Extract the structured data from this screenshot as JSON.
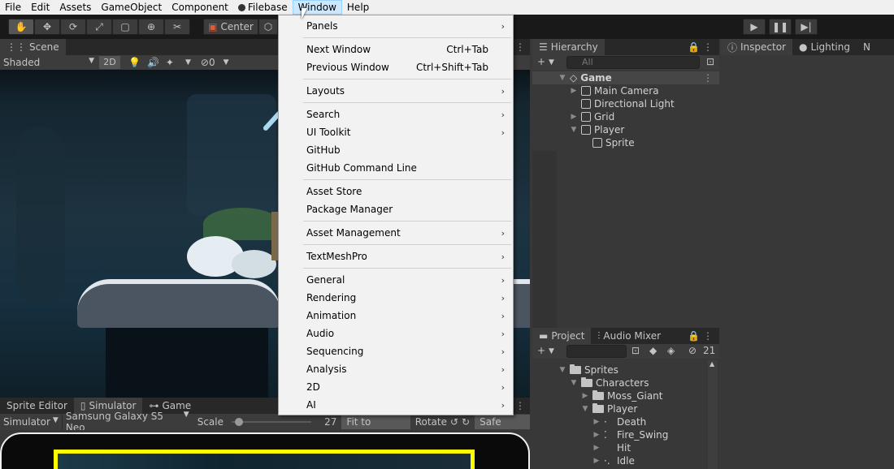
{
  "menubar": {
    "items": [
      "File",
      "Edit",
      "Assets",
      "GameObject",
      "Component",
      "Filebase",
      "Window",
      "Help"
    ],
    "active": "Window"
  },
  "toolbar": {
    "pivot_label": "Center"
  },
  "scene": {
    "tab_label": "Scene",
    "shading": "Shaded",
    "mode_2d": "2D",
    "hidden_count": "0"
  },
  "hierarchy": {
    "tab_label": "Hierarchy",
    "search_placeholder": "All",
    "rows": [
      {
        "label": "Game",
        "bold": true
      },
      {
        "label": "Main Camera"
      },
      {
        "label": "Directional Light"
      },
      {
        "label": "Grid"
      },
      {
        "label": "Player"
      },
      {
        "label": "Sprite"
      }
    ]
  },
  "inspector": {
    "tabs": [
      "Inspector",
      "Lighting",
      "N"
    ]
  },
  "project": {
    "tabs": [
      "Project",
      "Audio Mixer"
    ],
    "hidden_count": "21",
    "rows": [
      {
        "label": "Sprites"
      },
      {
        "label": "Characters"
      },
      {
        "label": "Moss_Giant"
      },
      {
        "label": "Player"
      },
      {
        "label": "Death"
      },
      {
        "label": "Fire_Swing"
      },
      {
        "label": "Hit"
      },
      {
        "label": "Idle"
      }
    ]
  },
  "bottom_tabs": [
    "Sprite Editor",
    "Simulator",
    "Game"
  ],
  "simulator": {
    "mode": "Simulator",
    "device": "Samsung Galaxy S5 Neo",
    "scale_label": "Scale",
    "scale_value": "27",
    "scale_fraction": 0.05,
    "fit_label": "Fit to Screen",
    "rotate_label": "Rotate",
    "safe_area_label": "Safe Area"
  },
  "window_menu": {
    "items": [
      {
        "label": "Panels",
        "submenu": true
      },
      {
        "label": "Next Window",
        "shortcut": "Ctrl+Tab"
      },
      {
        "label": "Previous Window",
        "shortcut": "Ctrl+Shift+Tab"
      },
      {
        "label": "Layouts",
        "submenu": true
      },
      {
        "label": "Search",
        "submenu": true
      },
      {
        "label": "UI Toolkit",
        "submenu": true
      },
      {
        "label": "GitHub"
      },
      {
        "label": "GitHub Command Line"
      },
      {
        "label": "Asset Store"
      },
      {
        "label": "Package Manager"
      },
      {
        "label": "Asset Management",
        "submenu": true
      },
      {
        "label": "TextMeshPro",
        "submenu": true
      },
      {
        "label": "General",
        "submenu": true
      },
      {
        "label": "Rendering",
        "submenu": true
      },
      {
        "label": "Animation",
        "submenu": true
      },
      {
        "label": "Audio",
        "submenu": true
      },
      {
        "label": "Sequencing",
        "submenu": true
      },
      {
        "label": "Analysis",
        "submenu": true
      },
      {
        "label": "2D",
        "submenu": true
      },
      {
        "label": "AI",
        "submenu": true
      }
    ]
  },
  "colors": {
    "accent_yellow": "#ffff00",
    "menu_highlight": "#cce8ff"
  }
}
